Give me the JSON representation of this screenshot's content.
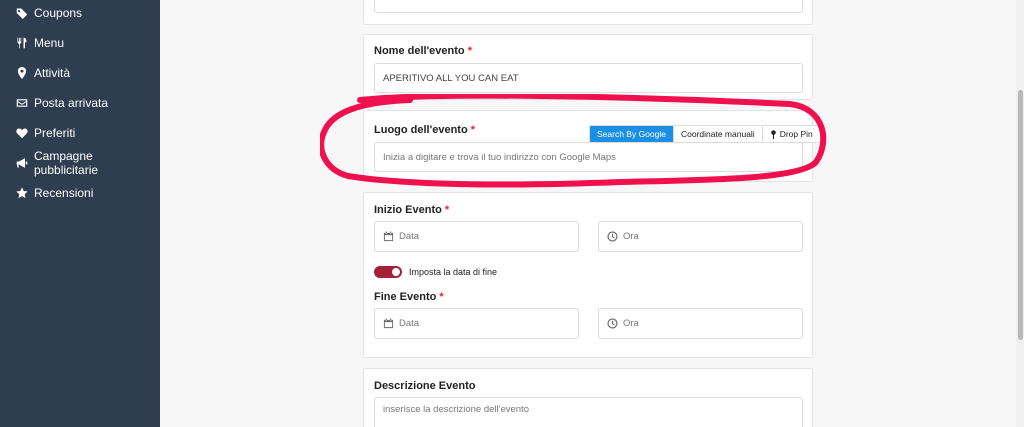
{
  "sidebar": {
    "items": [
      {
        "label": "Coupons",
        "icon": "tag-icon"
      },
      {
        "label": "Menu",
        "icon": "utensils-icon"
      },
      {
        "label": "Attività",
        "icon": "map-pin-icon"
      },
      {
        "label": "Posta arrivata",
        "icon": "envelope-icon"
      },
      {
        "label": "Preferiti",
        "icon": "heart-icon"
      },
      {
        "label": "Campagne pubblicitarie",
        "icon": "megaphone-icon"
      },
      {
        "label": "Recensioni",
        "icon": "star-icon"
      }
    ]
  },
  "form": {
    "name": {
      "label": "Nome dell'evento",
      "required": "*",
      "value": "APERITIVO ALL YOU CAN EAT"
    },
    "location": {
      "label": "Luogo dell'evento",
      "required": "*",
      "placeholder": "Inizia a digitare e trova il tuo indirizzo con Google Maps",
      "modes": [
        "Search By Google",
        "Coordinate manuali",
        "Drop Pin"
      ],
      "active_mode": "Search By Google"
    },
    "start": {
      "label": "Inizio Evento",
      "required": "*",
      "date_placeholder": "Data",
      "time_placeholder": "Ora"
    },
    "end_toggle": {
      "label": "Imposta la data di fine",
      "on": true
    },
    "end": {
      "label": "Fine Evento",
      "required": "*",
      "date_placeholder": "Data",
      "time_placeholder": "Ora"
    },
    "description": {
      "label": "Descrizione Evento",
      "placeholder": "inserisce la descrizione dell'evento"
    }
  },
  "colors": {
    "sidebar_bg": "#2e3d50",
    "accent_blue": "#1a8fe3",
    "toggle_on": "#a5203a",
    "required": "#e0202e",
    "annotation": "#f0104e"
  }
}
